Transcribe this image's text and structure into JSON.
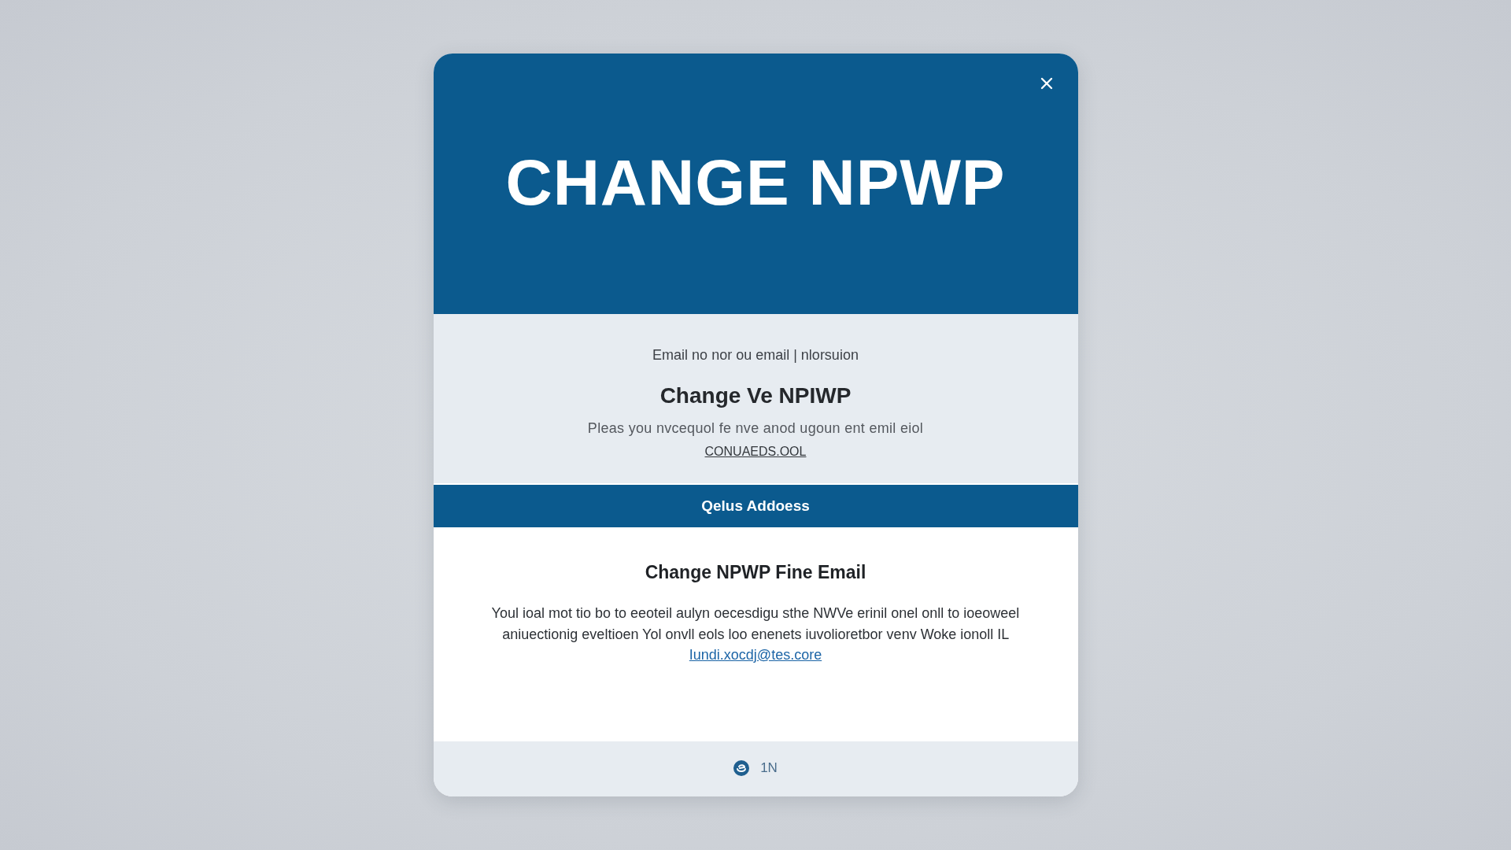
{
  "dialog": {
    "title": "CHANGE NPWP"
  },
  "notice": {
    "caption": "Email no nor ou email | nlorsuion",
    "heading": "Change Ve NPIWP",
    "text": "Pleas you nvcequol fe nve anod ugoun ent emil eiol",
    "link": "CONUAEDS.OOL"
  },
  "section_bar": {
    "label": "Qelus Addoess"
  },
  "content": {
    "heading": "Change NPWP Fine Email",
    "text": "Youl ioal mot tio bo to eeoteil aulyn oecesdigu sthe NWVe erinil onel onll to ioeoweel aniuectionig eveltioen Yol onvll eols loo enenets iuvolioretbor venv Woke ionoll IL",
    "link": "Iundi.xocdj@tes.core"
  },
  "footer": {
    "label": "1N"
  }
}
